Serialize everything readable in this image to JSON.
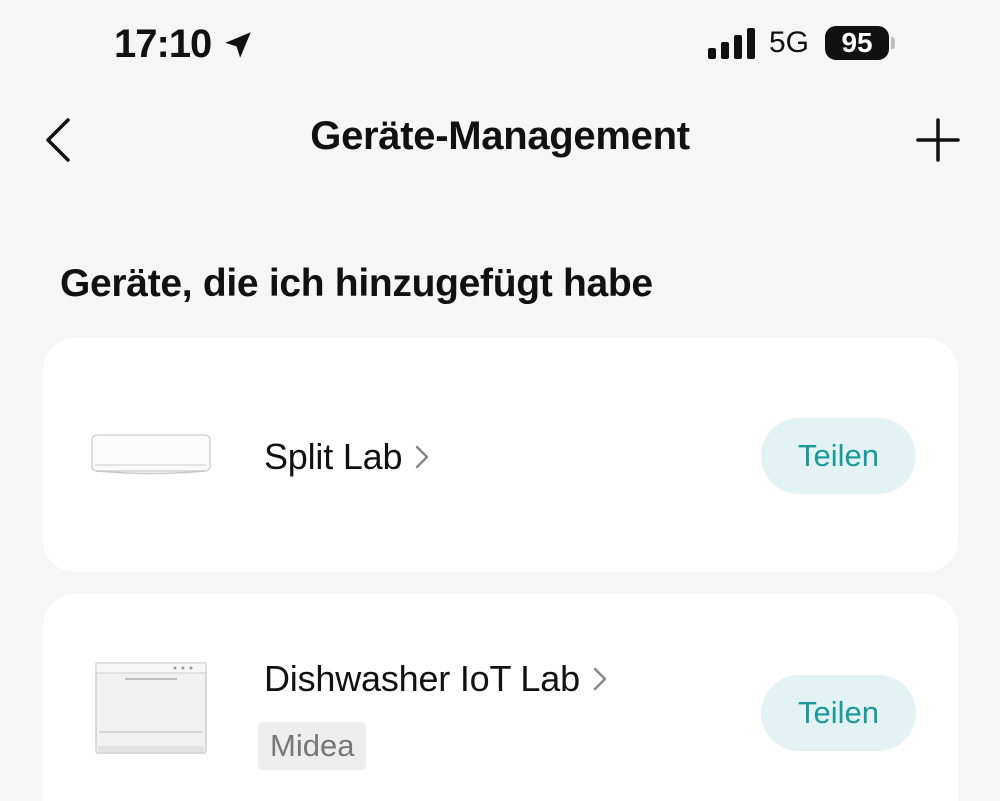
{
  "status_bar": {
    "time": "17:10",
    "network": "5G",
    "battery": "95"
  },
  "nav": {
    "title": "Geräte-Management"
  },
  "section": {
    "title": "Geräte, die ich hinzugefügt habe"
  },
  "devices": [
    {
      "name": "Split Lab",
      "share_label": "Teilen",
      "icon": "air-conditioner-icon"
    },
    {
      "name": "Dishwasher IoT Lab",
      "brand": "Midea",
      "share_label": "Teilen",
      "icon": "dishwasher-icon"
    }
  ],
  "colors": {
    "accent": "#1a9a9a",
    "accent_bg": "#e3f3f3",
    "background": "#f6f6f6"
  }
}
